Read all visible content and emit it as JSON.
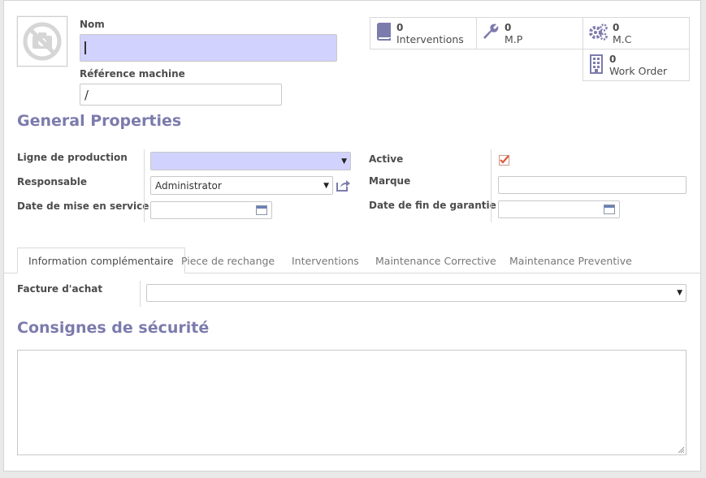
{
  "header": {
    "name_label": "Nom",
    "name_value": "",
    "ref_label": "Référence machine",
    "ref_value": "/"
  },
  "stats": {
    "interventions": {
      "count": "0",
      "label": "Interventions",
      "icon": "book-icon"
    },
    "mp": {
      "count": "0",
      "label": "M.P",
      "icon": "wrench-icon"
    },
    "mc": {
      "count": "0",
      "label": "M.C",
      "icon": "gears-icon"
    },
    "work_order": {
      "count": "0",
      "label": "Work Order",
      "icon": "building-icon"
    }
  },
  "general": {
    "title": "General Properties",
    "ligne_label": "Ligne de production",
    "ligne_value": "",
    "responsable_label": "Responsable",
    "responsable_value": "Administrator",
    "date_service_label": "Date de mise en service",
    "date_service_value": "",
    "active_label": "Active",
    "active_checked": true,
    "marque_label": "Marque",
    "marque_value": "",
    "date_garantie_label": "Date de fin de garantie",
    "date_garantie_value": ""
  },
  "tabs": [
    {
      "label": "Information complémentaire",
      "active": true
    },
    {
      "label": "Piece de rechange",
      "active": false
    },
    {
      "label": "Interventions",
      "active": false
    },
    {
      "label": "Maintenance Corrective",
      "active": false
    },
    {
      "label": "Maintenance Preventive",
      "active": false
    }
  ],
  "info_tab": {
    "facture_label": "Facture d'achat",
    "facture_value": ""
  },
  "safety": {
    "title": "Consignes de sécurité",
    "value": ""
  },
  "colors": {
    "accent": "#7c7bad",
    "required_bg": "#d2d2ff",
    "checkbox_check": "#e0573a"
  }
}
